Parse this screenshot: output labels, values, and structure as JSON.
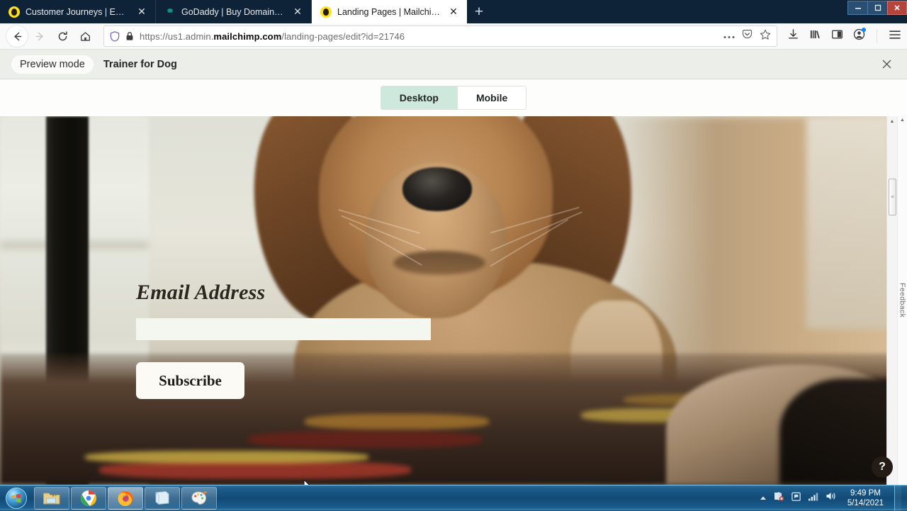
{
  "browser": {
    "tabs": [
      {
        "title": "Customer Journeys | Explore | M",
        "favicon": "mailchimp-icon",
        "active": false
      },
      {
        "title": "GoDaddy | Buy Domain Names",
        "favicon": "godaddy-icon",
        "active": false
      },
      {
        "title": "Landing Pages | Mailchimp",
        "favicon": "mailchimp-icon",
        "active": true
      }
    ],
    "new_tab_label": "+",
    "close_tab_label": "✕",
    "window_controls": {
      "minimize": "–",
      "restore": "❐",
      "close": "✕"
    },
    "nav": {
      "back": "←",
      "forward": "→",
      "reload": "⟳",
      "home": "⌂"
    },
    "url": {
      "protocol": "https://",
      "subdomain": "us1.admin.",
      "domain": "mailchimp.com",
      "path": "/landing-pages/edit?id=21746",
      "full": "https://us1.admin.mailchimp.com/landing-pages/edit?id=21746",
      "shield_icon": "shield-icon",
      "lock_icon": "padlock-icon",
      "more_icon": "ellipsis-icon",
      "pocket_icon": "pocket-icon",
      "bookmark_icon": "star-icon"
    },
    "toolbar_right": {
      "downloads": "downloads-icon",
      "library": "library-icon",
      "sidebar": "sidebar-icon",
      "account": "account-icon",
      "menu": "hamburger-menu-icon"
    }
  },
  "preview_bar": {
    "mode_label": "Preview mode",
    "page_title": "Trainer for Dog",
    "close_label": "✕"
  },
  "device_tabs": [
    {
      "label": "Desktop",
      "active": true
    },
    {
      "label": "Mobile",
      "active": false
    }
  ],
  "landing_page": {
    "form_label": "Email Address",
    "input_value": "",
    "input_placeholder": "",
    "button_label": "Subscribe",
    "background_image": "golden-retriever-puppy-on-blanket"
  },
  "side_rail": {
    "feedback_label": "Feedback",
    "scroll_up_arrow": "▲",
    "scroll_thumb_grip": "≡"
  },
  "help_button": {
    "label": "?"
  },
  "taskbar": {
    "start_label": "start-orb-icon",
    "items": [
      {
        "name": "file-explorer-icon",
        "active": false
      },
      {
        "name": "google-chrome-icon",
        "active": false
      },
      {
        "name": "mozilla-firefox-icon",
        "active": true
      },
      {
        "name": "sticky-notes-icon",
        "active": false
      },
      {
        "name": "paint-icon",
        "active": false
      }
    ],
    "tray": {
      "show_hidden": "▲",
      "network_icon": "network-error-icon",
      "action_center_icon": "flag-icon",
      "signal_icon": "signal-bars-icon",
      "volume_icon": "speaker-icon"
    },
    "clock": {
      "time": "9:49 PM",
      "date": "5/14/2021"
    }
  },
  "colors": {
    "active_device_tab": "#cfe8dc",
    "preview_bar_bg": "#eceeea",
    "tabstrip_bg": "#0f2338",
    "accent_blue": "#0a84ff",
    "taskbar_blue": "#124a76",
    "help_button_bg": "#241c15"
  }
}
